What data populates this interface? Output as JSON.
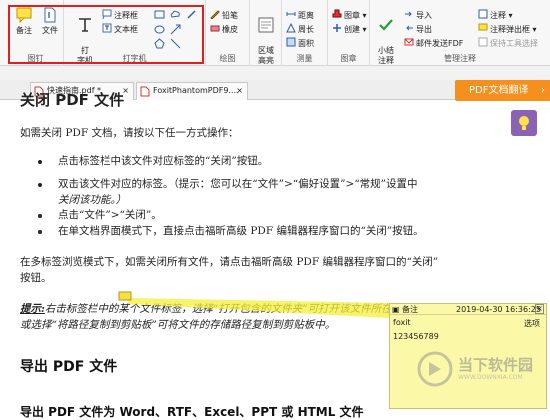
{
  "ribbon": {
    "groups": {
      "annotate": {
        "label": "图钉",
        "note": "备注",
        "file": "文件"
      },
      "typewriter": {
        "label": "打字机",
        "typewriter": "打\n字机",
        "annotation": "注释框",
        "textbox": "文本框"
      },
      "drawing": {
        "label": "绘图",
        "pencil": "铅笔",
        "eraser": "橡皮"
      },
      "area": {
        "highlight": "区域\n高亮"
      },
      "measure": {
        "label": "测量",
        "distance": "距离",
        "perimeter": "周长",
        "area": "面积"
      },
      "stamp": {
        "label": "图章",
        "stamp": "图章",
        "create": "创建"
      },
      "manage": {
        "label": "管理注释",
        "summarize": "小结\n注释",
        "import": "导入",
        "export": "导出",
        "email_pdf": "邮件发送FDF",
        "notes": "注释",
        "popup_notes": "注释弹出框",
        "keep_tool": "保持工具选择"
      }
    }
  },
  "tabs": [
    {
      "label": "快速指南.pdf *"
    },
    {
      "label": "FoxitPhantomPDF9...."
    }
  ],
  "translate_button": "PDF文档翻译",
  "document": {
    "heading_partial": "关闭 PDF 文件",
    "intro": "如需关闭 PDF 文档，请按以下任一方式操作：",
    "bullets": [
      "点击标签栏中该文件对应标签的“关闭”按钮。",
      "双击该文件对应的标签。（提示：您可以在“文件”>“偏好设置”>“常规”设置中",
      "关闭该功能。）",
      "点击“文件”>“关闭”。",
      "在单文档界面模式下，直接点击福昕高级 PDF 编辑器程序窗口的“关闭”按钮。"
    ],
    "para2_line1": "在多标签浏览模式下，如需关闭所有文件，请点击福昕高级 PDF 编辑器程序窗口的“关闭”",
    "para2_line2": "按钮。",
    "tip_label": "提示:",
    "tip_line1": "右击标签栏中的某个文件标签，选择“打开包含的文件夹”可打开该文件所在的目录，",
    "tip_line2": "或选择“将路径复制到剪贴板”可将文件的存储路径复制到剪贴板中。",
    "export_heading": "导出 PDF 文件",
    "export_sub": "导出 PDF 文件为 Word、RTF、Excel、PPT 或 HTML 文件"
  },
  "note_popup": {
    "title": "备注",
    "date": "2019-04-30 16:36:25",
    "author": "foxit",
    "options": "选项",
    "content": "123456789"
  },
  "watermark": {
    "text": "当下软件园",
    "sub": "WWW.DOWNXIA.COM"
  }
}
